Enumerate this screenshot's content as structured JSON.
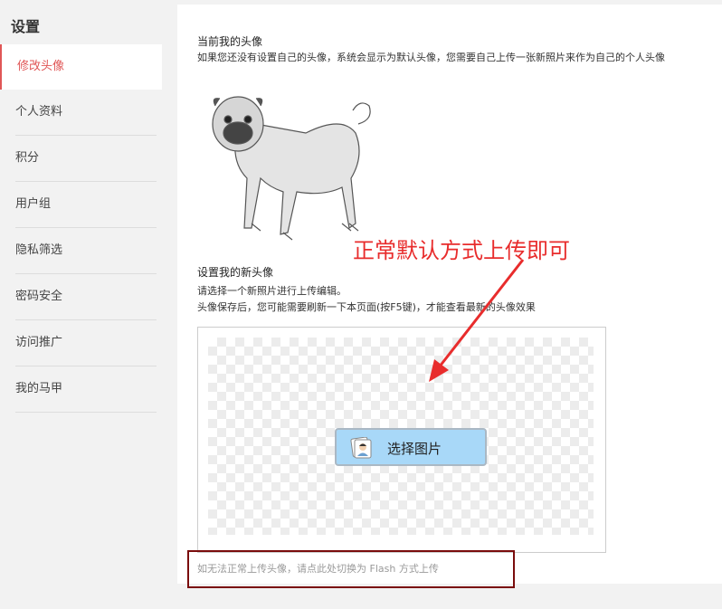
{
  "sidebar": {
    "title": "设置",
    "items": [
      {
        "label": "修改头像",
        "active": true
      },
      {
        "label": "个人资料"
      },
      {
        "label": "积分"
      },
      {
        "label": "用户组"
      },
      {
        "label": "隐私筛选"
      },
      {
        "label": "密码安全"
      },
      {
        "label": "访问推广"
      },
      {
        "label": "我的马甲"
      }
    ]
  },
  "current_avatar": {
    "title": "当前我的头像",
    "desc": "如果您还没有设置自己的头像，系统会显示为默认头像，您需要自己上传一张新照片来作为自己的个人头像"
  },
  "new_avatar": {
    "title": "设置我的新头像",
    "desc1": "请选择一个新照片进行上传编辑。",
    "desc2": "头像保存后，您可能需要刷新一下本页面(按F5键)，才能查看最新的头像效果"
  },
  "upload": {
    "button_label": "选择图片",
    "icon": "photo-icon"
  },
  "flash_link": "如无法正常上传头像，请点此处切换为 Flash 方式上传",
  "annotation": {
    "text": "正常默认方式上传即可",
    "color": "#e82c2c"
  },
  "colors": {
    "active_accent": "#e05656",
    "button_bg": "#a8d8f8",
    "frame": "#7a0c0c"
  }
}
